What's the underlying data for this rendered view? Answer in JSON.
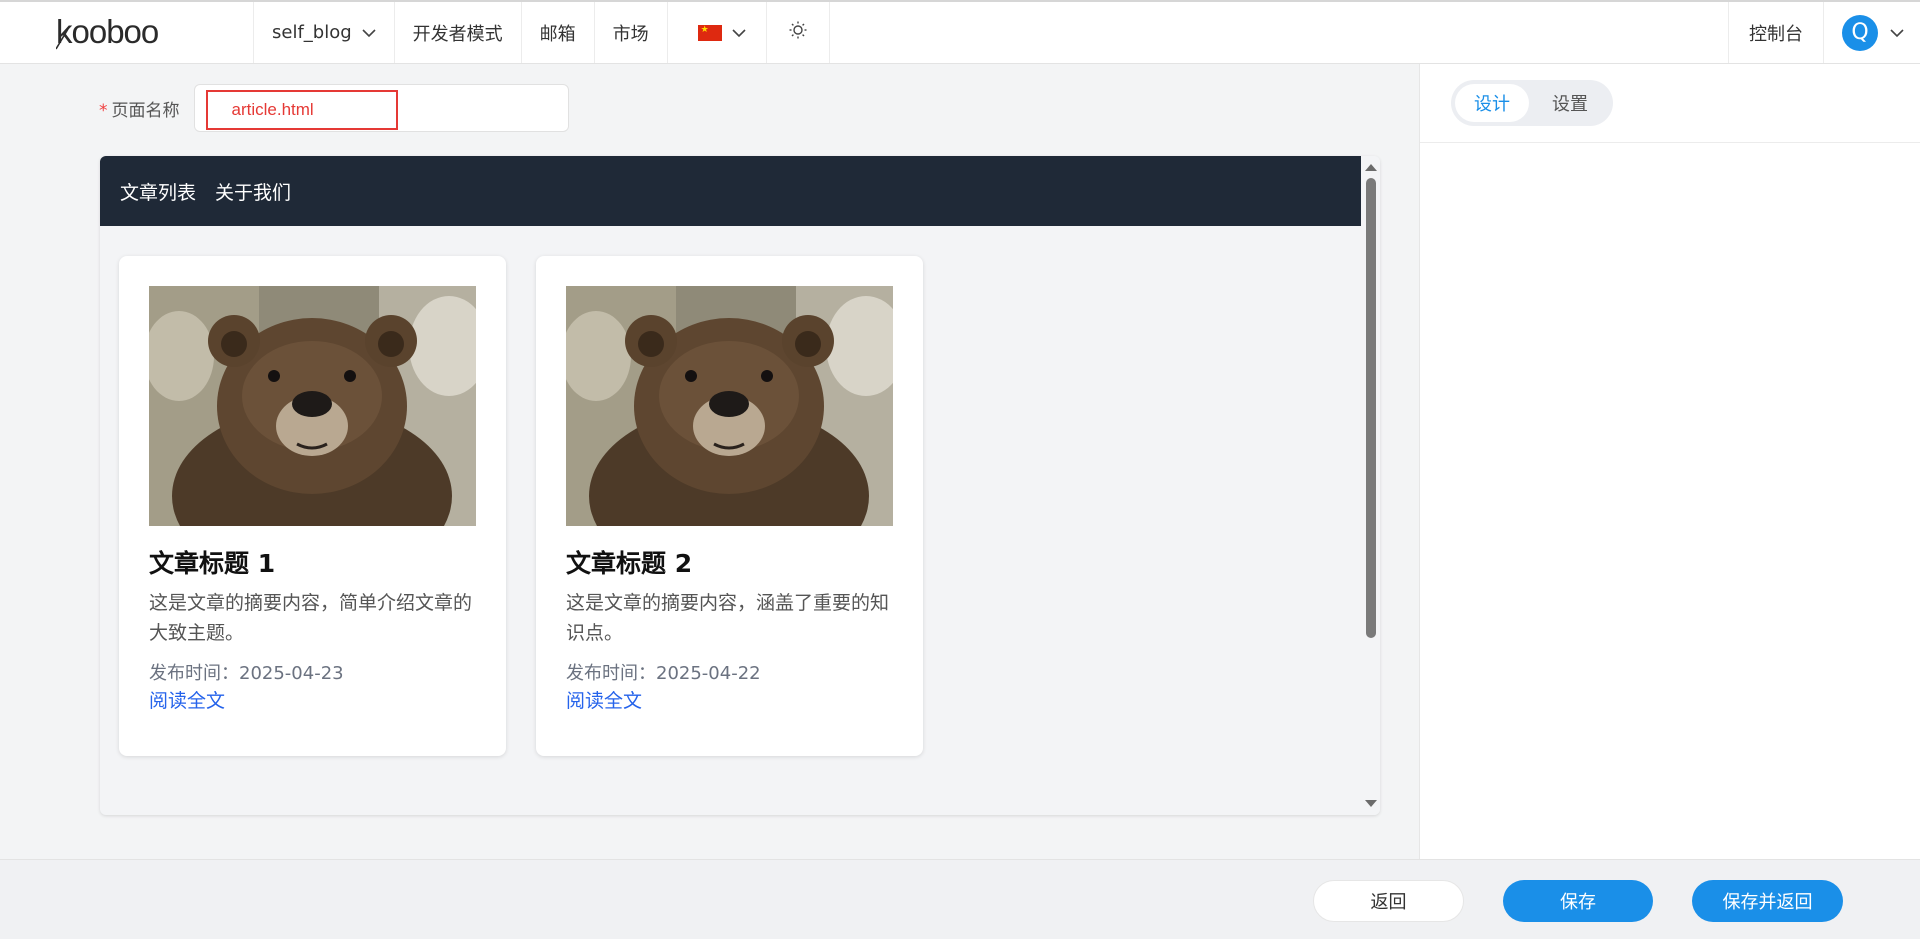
{
  "header": {
    "logo_text": "kooboo",
    "site_selector": "self_blog",
    "dev_mode": "开发者模式",
    "mail": "邮箱",
    "market": "市场",
    "language_icon": "china-flag-icon",
    "theme_icon": "sun-icon",
    "console": "控制台",
    "avatar_letter": "Q"
  },
  "form": {
    "page_name_required_mark": "*",
    "page_name_label": "页面名称",
    "page_name_value": "article.html"
  },
  "preview": {
    "nav": [
      "文章列表",
      "关于我们"
    ],
    "articles": [
      {
        "title": "文章标题 1",
        "summary": "这是文章的摘要内容，简单介绍文章的大致主题。",
        "date": "发布时间：2025-04-23",
        "link": "阅读全文",
        "image": "bear-photo"
      },
      {
        "title": "文章标题 2",
        "summary": "这是文章的摘要内容，涵盖了重要的知识点。",
        "date": "发布时间：2025-04-22",
        "link": "阅读全文",
        "image": "bear-photo"
      }
    ]
  },
  "right_panel": {
    "tabs": [
      "设计",
      "设置"
    ],
    "active_tab": "设计"
  },
  "footer": {
    "back": "返回",
    "save": "保存",
    "save_and_back": "保存并返回"
  },
  "colors": {
    "accent": "#1a8fe8",
    "preview_nav_bg": "#1f2937",
    "link": "#2563eb",
    "highlight_border": "#e53935"
  }
}
